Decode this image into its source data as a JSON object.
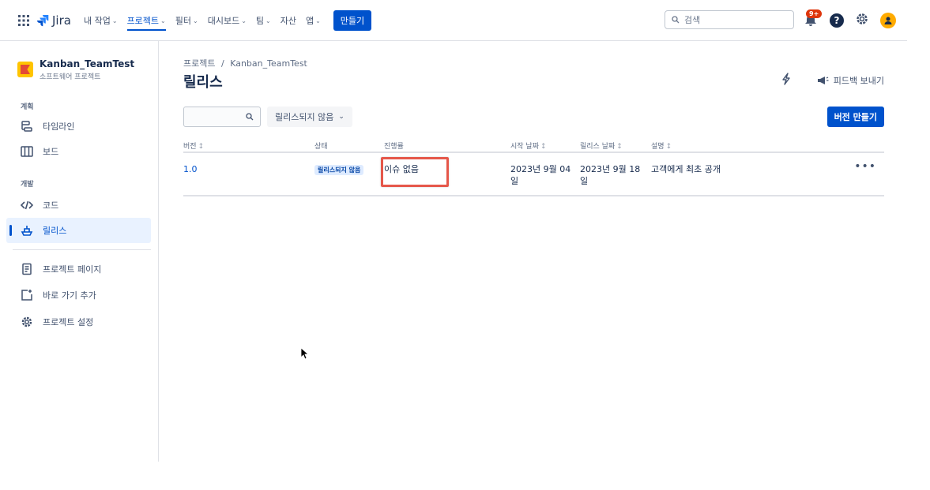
{
  "topbar": {
    "logo": "Jira",
    "nav": [
      {
        "label": "내 작업",
        "dropdown": true
      },
      {
        "label": "프로젝트",
        "dropdown": true,
        "active": true
      },
      {
        "label": "필터",
        "dropdown": true
      },
      {
        "label": "대시보드",
        "dropdown": true
      },
      {
        "label": "팀",
        "dropdown": true
      },
      {
        "label": "자산",
        "dropdown": false
      },
      {
        "label": "앱",
        "dropdown": true
      }
    ],
    "create_label": "만들기",
    "search_placeholder": "검색",
    "notification_badge": "9+",
    "accent": "#0052cc"
  },
  "sidebar": {
    "project_name": "Kanban_TeamTest",
    "project_type": "소프트웨어 프로젝트",
    "sections": {
      "planning": "계획",
      "development": "개발"
    },
    "items": [
      {
        "label": "타임라인",
        "icon": "timeline-icon"
      },
      {
        "label": "보드",
        "icon": "board-icon"
      },
      {
        "label": "코드",
        "icon": "code-icon"
      },
      {
        "label": "릴리스",
        "icon": "release-icon",
        "active": true
      },
      {
        "label": "프로젝트 페이지",
        "icon": "page-icon"
      },
      {
        "label": "바로 가기 추가",
        "icon": "add-shortcut-icon"
      },
      {
        "label": "프로젝트 설정",
        "icon": "settings-icon"
      }
    ]
  },
  "main": {
    "breadcrumb_root": "프로젝트",
    "breadcrumb_sep": "/",
    "breadcrumb_project": "Kanban_TeamTest",
    "title": "릴리스",
    "feedback_label": "피드백 보내기",
    "status_filter": "릴리스되지 않음",
    "create_version_label": "버전 만들기",
    "columns": {
      "version": "버전",
      "status": "상태",
      "progress": "진행률",
      "start_date": "시작 날짜",
      "release_date": "릴리스 날짜",
      "description": "설명"
    },
    "rows": [
      {
        "version": "1.0",
        "status": "릴리스되지 않음",
        "progress": "이슈 없음",
        "start_date_line1": "2023년 9월 04",
        "start_date_line2": "일",
        "release_date_line1": "2023년 9월 18",
        "release_date_line2": "일",
        "description": "고객에게 최초 공개",
        "more": "•••"
      }
    ]
  }
}
